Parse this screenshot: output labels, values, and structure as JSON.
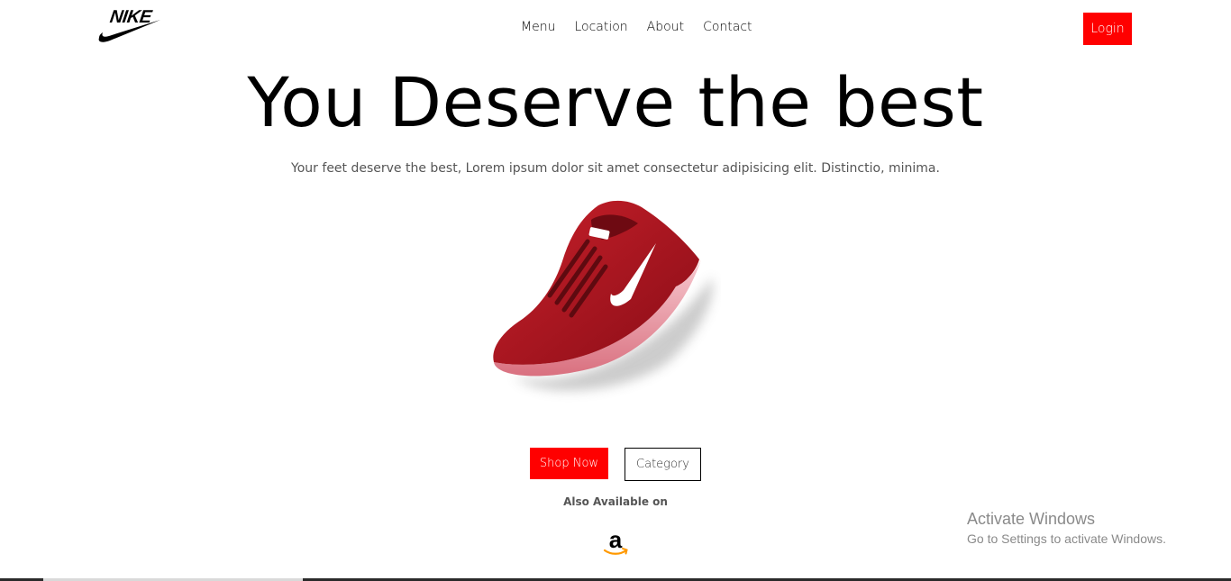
{
  "header": {
    "logo_text": "NIKE",
    "nav": [
      "Menu",
      "Location",
      "About",
      "Contact"
    ],
    "login_label": "Login"
  },
  "hero": {
    "title": "You Deserve the best",
    "subtitle": "Your feet deserve the best, Lorem ipsum dolor sit amet consectetur adipisicing elit. Distinctio, minima.",
    "shop_label": "Shop Now",
    "category_label": "Category",
    "also_available": "Also Available on",
    "amazon_letter": "a"
  },
  "watermark": {
    "title": "Activate Windows",
    "subtitle": "Go to Settings to activate Windows."
  },
  "colors": {
    "accent": "#ff0000",
    "text": "#000000",
    "muted": "#555555",
    "shoe": "#b3121f",
    "amazon_arrow": "#ff9900"
  },
  "icons": [
    "nike-swoosh-icon",
    "amazon-icon"
  ]
}
